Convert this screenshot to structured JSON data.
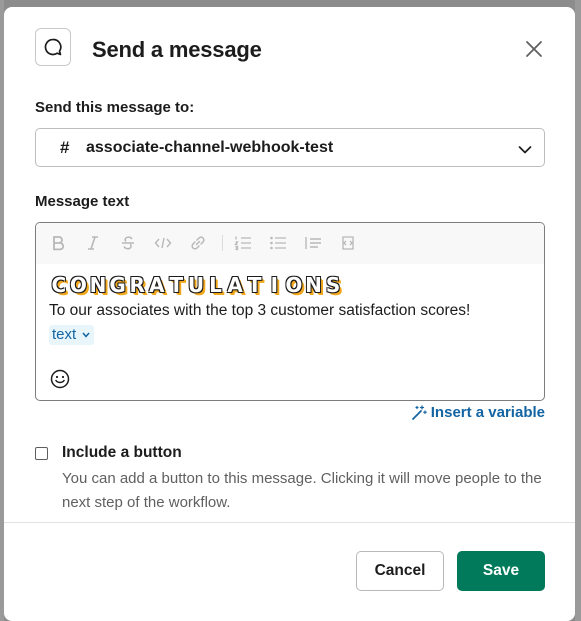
{
  "modal": {
    "title": "Send a message",
    "close_icon": "close-icon",
    "header_icon": "chat-bubble-icon"
  },
  "recipient": {
    "label": "Send this message to:",
    "prefix": "#",
    "value": "associate-channel-webhook-test"
  },
  "message": {
    "label": "Message text",
    "toolbar": [
      "bold-icon",
      "italic-icon",
      "strikethrough-icon",
      "code-icon",
      "link-icon",
      "ordered-list-icon",
      "bulleted-list-icon",
      "blockquote-icon",
      "code-block-icon"
    ],
    "emoji_letters": [
      "C",
      "O",
      "N",
      "G",
      "R",
      "A",
      "T",
      "U",
      "L",
      "A",
      "T",
      "I",
      "O",
      "N",
      "S"
    ],
    "body": "To our associates with the top 3 customer satisfaction scores!",
    "variable": "text",
    "emoji_button_icon": "smiley-icon"
  },
  "insert_variable": "Insert a variable",
  "include_button": {
    "label": "Include a button",
    "checked": false,
    "description": "You can add a button to this message. Clicking it will move people to the next step of the workflow."
  },
  "footer": {
    "cancel": "Cancel",
    "save": "Save"
  },
  "colors": {
    "primary": "#007a5a",
    "link": "#1264a3",
    "variable_bg": "#e8f5fa"
  }
}
